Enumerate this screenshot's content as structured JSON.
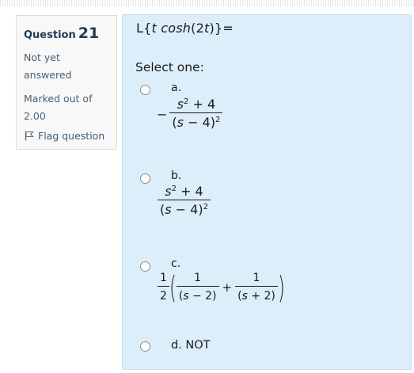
{
  "info": {
    "question_label": "Question",
    "question_number": "21",
    "status_line1": "Not yet",
    "status_line2": "answered",
    "marks_line1": "Marked out of",
    "marks_line2": "2.00",
    "flag_label": "Flag question"
  },
  "question": {
    "prefix": "L{",
    "t": "t",
    "func": "cosh",
    "arg": "(2",
    "t2": "t",
    "suffix": ")}="
  },
  "prompt": "Select one:",
  "options": {
    "a": {
      "letter": "a.",
      "sign": "−",
      "num_var": "s",
      "num_exp": "2",
      "num_rest": " + 4",
      "den_open": "(",
      "den_var": "s",
      "den_rest": " − 4)",
      "den_exp": "2"
    },
    "b": {
      "letter": "b.",
      "num_var": "s",
      "num_exp": "2",
      "num_rest": " + 4",
      "den_open": "(",
      "den_var": "s",
      "den_rest": " − 4)",
      "den_exp": "2"
    },
    "c": {
      "letter": "c.",
      "outer_num": "1",
      "outer_den": "2",
      "left_paren": "(",
      "f1_num": "1",
      "f1_den_open": "(",
      "f1_den_var": "s",
      "f1_den_rest": " − 2)",
      "plus": "+",
      "f2_num": "1",
      "f2_den_open": "(",
      "f2_den_var": "s",
      "f2_den_rest": " + 2)",
      "right_paren": ")"
    },
    "d": {
      "label": "d. NOT"
    }
  },
  "colors": {
    "panel_bg": "#dceefa",
    "info_bg": "#f8f8f8",
    "heading": "#1f3a54"
  },
  "icons": {
    "flag": "flag-icon",
    "radio": "radio-circle"
  }
}
